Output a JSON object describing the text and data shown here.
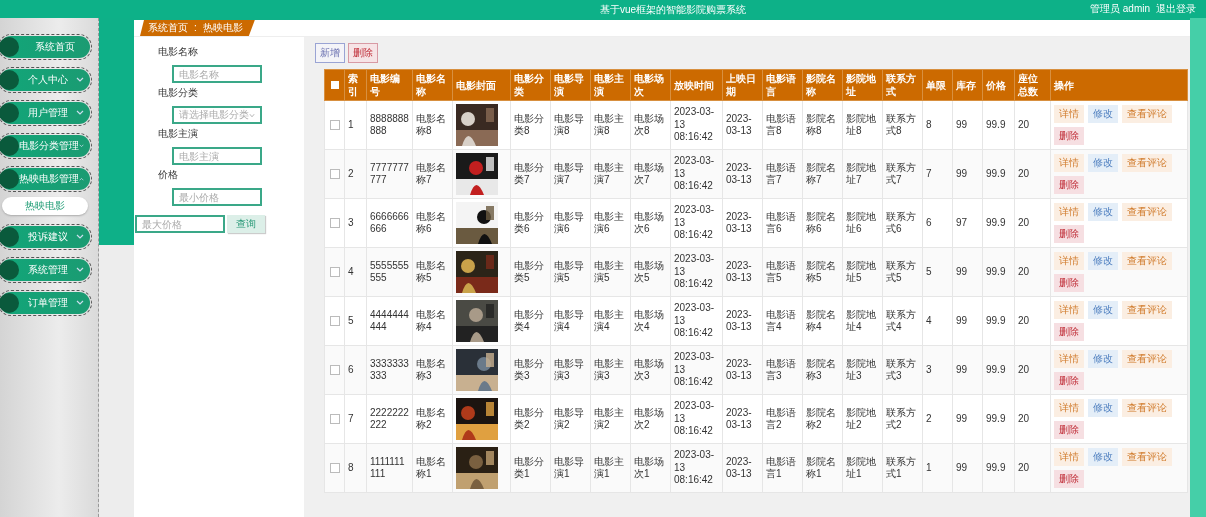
{
  "header": {
    "title": "基于vue框架的智能影院购票系统",
    "user": "管理员 admin",
    "logout": "退出登录"
  },
  "sidebar": {
    "items": [
      {
        "label": "系统首页",
        "kind": "link"
      },
      {
        "label": "个人中心",
        "kind": "group",
        "expanded": false
      },
      {
        "label": "用户管理",
        "kind": "group",
        "expanded": false
      },
      {
        "label": "电影分类管理",
        "kind": "group",
        "expanded": false
      },
      {
        "label": "热映电影管理",
        "kind": "group",
        "expanded": true,
        "children": [
          {
            "label": "热映电影",
            "selected": true
          }
        ]
      },
      {
        "label": "投诉建议",
        "kind": "group",
        "expanded": false
      },
      {
        "label": "系统管理",
        "kind": "group",
        "expanded": false
      },
      {
        "label": "订单管理",
        "kind": "group",
        "expanded": false
      }
    ]
  },
  "breadcrumb": {
    "items": [
      "系统首页",
      "热映电影"
    ],
    "separator": ":"
  },
  "filters": [
    {
      "label": "电影名称",
      "kind": "input",
      "placeholder": "电影名称"
    },
    {
      "label": "电影分类",
      "kind": "select",
      "placeholder": "请选择电影分类"
    },
    {
      "label": "电影主演",
      "kind": "input",
      "placeholder": "电影主演"
    },
    {
      "label": "价格",
      "kind": "input",
      "placeholder": "最小价格"
    }
  ],
  "max_price": {
    "placeholder": "最大价格"
  },
  "search_button": "查询",
  "toolbar": [
    {
      "label": "新增",
      "kind": "add"
    },
    {
      "label": "删除",
      "kind": "delete"
    }
  ],
  "table": {
    "select_all": {
      "checked": false
    },
    "columns": [
      "索引",
      "电影编号",
      "电影名称",
      "电影封面",
      "电影分类",
      "电影导演",
      "电影主演",
      "电影场次",
      "放映时间",
      "上映日期",
      "电影语言",
      "影院名称",
      "影院地址",
      "联系方式",
      "单限",
      "库存",
      "价格",
      "座位总数",
      "操作"
    ],
    "rows": [
      {
        "checked": false,
        "cells": [
          "1",
          "8888888888",
          "电影名称8",
          {
            "kind": "picture"
          },
          "电影分类8",
          "电影导演8",
          "电影主演8",
          "电影场次8",
          "2023-03-13 08:16:42",
          "2023-03-13",
          "电影语言8",
          "影院名称8",
          "影院地址8",
          "联系方式8",
          "8",
          "99",
          "99.9",
          "20"
        ],
        "actions": [
          {
            "label": "详情",
            "kind": "detail"
          },
          {
            "label": "修改",
            "kind": "edit"
          },
          {
            "label": "查看评论",
            "kind": "comment"
          },
          {
            "label": "删除",
            "kind": "delete"
          }
        ]
      },
      {
        "checked": false,
        "cells": [
          "2",
          "7777777777",
          "电影名称7",
          {
            "kind": "picture"
          },
          "电影分类7",
          "电影导演7",
          "电影主演7",
          "电影场次7",
          "2023-03-13 08:16:42",
          "2023-03-13",
          "电影语言7",
          "影院名称7",
          "影院地址7",
          "联系方式7",
          "7",
          "99",
          "99.9",
          "20"
        ],
        "actions": [
          {
            "label": "详情",
            "kind": "detail"
          },
          {
            "label": "修改",
            "kind": "edit"
          },
          {
            "label": "查看评论",
            "kind": "comment"
          },
          {
            "label": "删除",
            "kind": "delete"
          }
        ]
      },
      {
        "checked": false,
        "cells": [
          "3",
          "6666666666",
          "电影名称6",
          {
            "kind": "picture"
          },
          "电影分类6",
          "电影导演6",
          "电影主演6",
          "电影场次6",
          "2023-03-13 08:16:42",
          "2023-03-13",
          "电影语言6",
          "影院名称6",
          "影院地址6",
          "联系方式6",
          "6",
          "97",
          "99.9",
          "20"
        ],
        "actions": [
          {
            "label": "详情",
            "kind": "detail"
          },
          {
            "label": "修改",
            "kind": "edit"
          },
          {
            "label": "查看评论",
            "kind": "comment"
          },
          {
            "label": "删除",
            "kind": "delete"
          }
        ]
      },
      {
        "checked": false,
        "cells": [
          "4",
          "5555555555",
          "电影名称5",
          {
            "kind": "picture"
          },
          "电影分类5",
          "电影导演5",
          "电影主演5",
          "电影场次5",
          "2023-03-13 08:16:42",
          "2023-03-13",
          "电影语言5",
          "影院名称5",
          "影院地址5",
          "联系方式5",
          "5",
          "99",
          "99.9",
          "20"
        ],
        "actions": [
          {
            "label": "详情",
            "kind": "detail"
          },
          {
            "label": "修改",
            "kind": "edit"
          },
          {
            "label": "查看评论",
            "kind": "comment"
          },
          {
            "label": "删除",
            "kind": "delete"
          }
        ]
      },
      {
        "checked": false,
        "cells": [
          "5",
          "4444444444",
          "电影名称4",
          {
            "kind": "picture"
          },
          "电影分类4",
          "电影导演4",
          "电影主演4",
          "电影场次4",
          "2023-03-13 08:16:42",
          "2023-03-13",
          "电影语言4",
          "影院名称4",
          "影院地址4",
          "联系方式4",
          "4",
          "99",
          "99.9",
          "20"
        ],
        "actions": [
          {
            "label": "详情",
            "kind": "detail"
          },
          {
            "label": "修改",
            "kind": "edit"
          },
          {
            "label": "查看评论",
            "kind": "comment"
          },
          {
            "label": "删除",
            "kind": "delete"
          }
        ]
      },
      {
        "checked": false,
        "cells": [
          "6",
          "3333333333",
          "电影名称3",
          {
            "kind": "picture"
          },
          "电影分类3",
          "电影导演3",
          "电影主演3",
          "电影场次3",
          "2023-03-13 08:16:42",
          "2023-03-13",
          "电影语言3",
          "影院名称3",
          "影院地址3",
          "联系方式3",
          "3",
          "99",
          "99.9",
          "20"
        ],
        "actions": [
          {
            "label": "详情",
            "kind": "detail"
          },
          {
            "label": "修改",
            "kind": "edit"
          },
          {
            "label": "查看评论",
            "kind": "comment"
          },
          {
            "label": "删除",
            "kind": "delete"
          }
        ]
      },
      {
        "checked": false,
        "cells": [
          "7",
          "2222222222",
          "电影名称2",
          {
            "kind": "picture"
          },
          "电影分类2",
          "电影导演2",
          "电影主演2",
          "电影场次2",
          "2023-03-13 08:16:42",
          "2023-03-13",
          "电影语言2",
          "影院名称2",
          "影院地址2",
          "联系方式2",
          "2",
          "99",
          "99.9",
          "20"
        ],
        "actions": [
          {
            "label": "详情",
            "kind": "detail"
          },
          {
            "label": "修改",
            "kind": "edit"
          },
          {
            "label": "查看评论",
            "kind": "comment"
          },
          {
            "label": "删除",
            "kind": "delete"
          }
        ]
      },
      {
        "checked": false,
        "cells": [
          "8",
          "1111111111",
          "电影名称1",
          {
            "kind": "picture"
          },
          "电影分类1",
          "电影导演1",
          "电影主演1",
          "电影场次1",
          "2023-03-13 08:16:42",
          "2023-03-13",
          "电影语言1",
          "影院名称1",
          "影院地址1",
          "联系方式1",
          "1",
          "99",
          "99.9",
          "20"
        ],
        "actions": [
          {
            "label": "详情",
            "kind": "detail"
          },
          {
            "label": "修改",
            "kind": "edit"
          },
          {
            "label": "查看评论",
            "kind": "comment"
          },
          {
            "label": "删除",
            "kind": "delete"
          }
        ]
      }
    ]
  }
}
